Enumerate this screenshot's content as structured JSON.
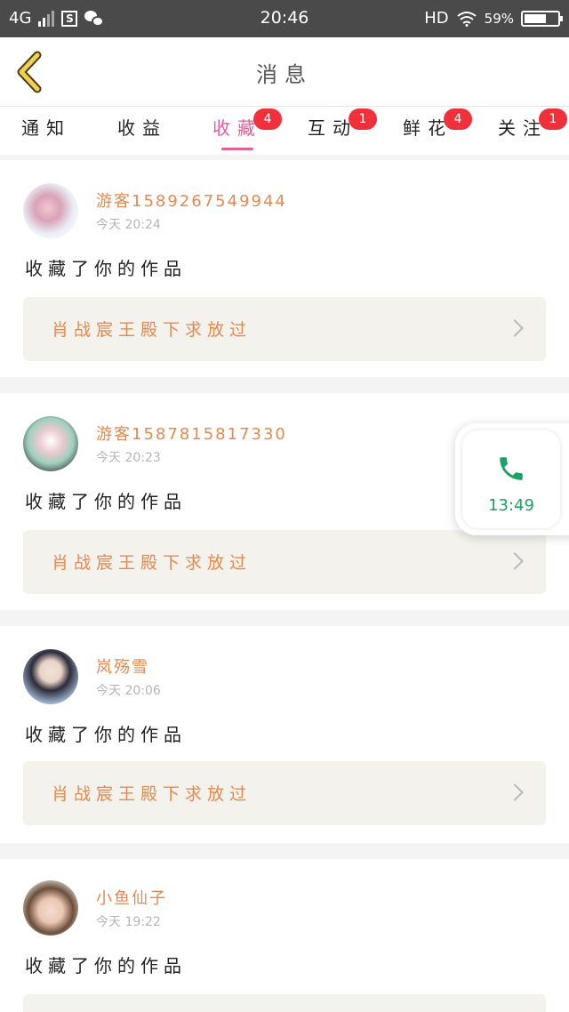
{
  "status_bar": {
    "network": "4G",
    "time": "20:46",
    "hd": "HD",
    "battery": "59%"
  },
  "header": {
    "title": "消息"
  },
  "tabs": [
    {
      "label": "通知",
      "badge": ""
    },
    {
      "label": "收益",
      "badge": ""
    },
    {
      "label": "收藏",
      "badge": "4"
    },
    {
      "label": "互动",
      "badge": "1"
    },
    {
      "label": "鲜花",
      "badge": "4"
    },
    {
      "label": "关注",
      "badge": "1"
    }
  ],
  "messages": [
    {
      "user": "游客1589267549944",
      "time": "今天 20:24",
      "action": "收藏了你的作品",
      "work": "肖战宸王殿下求放过"
    },
    {
      "user": "游客1587815817330",
      "time": "今天 20:23",
      "action": "收藏了你的作品",
      "work": "肖战宸王殿下求放过"
    },
    {
      "user": "岚殇雪",
      "time": "今天 20:06",
      "action": "收藏了你的作品",
      "work": "肖战宸王殿下求放过"
    },
    {
      "user": "小鱼仙子",
      "time": "今天 19:22",
      "action": "收藏了你的作品",
      "work": ""
    }
  ],
  "call_widget": {
    "duration": "13:49"
  },
  "colors": {
    "accent": "#e0609a",
    "username": "#e58a4f",
    "badge": "#f0303a",
    "call_green": "#1aa365"
  }
}
